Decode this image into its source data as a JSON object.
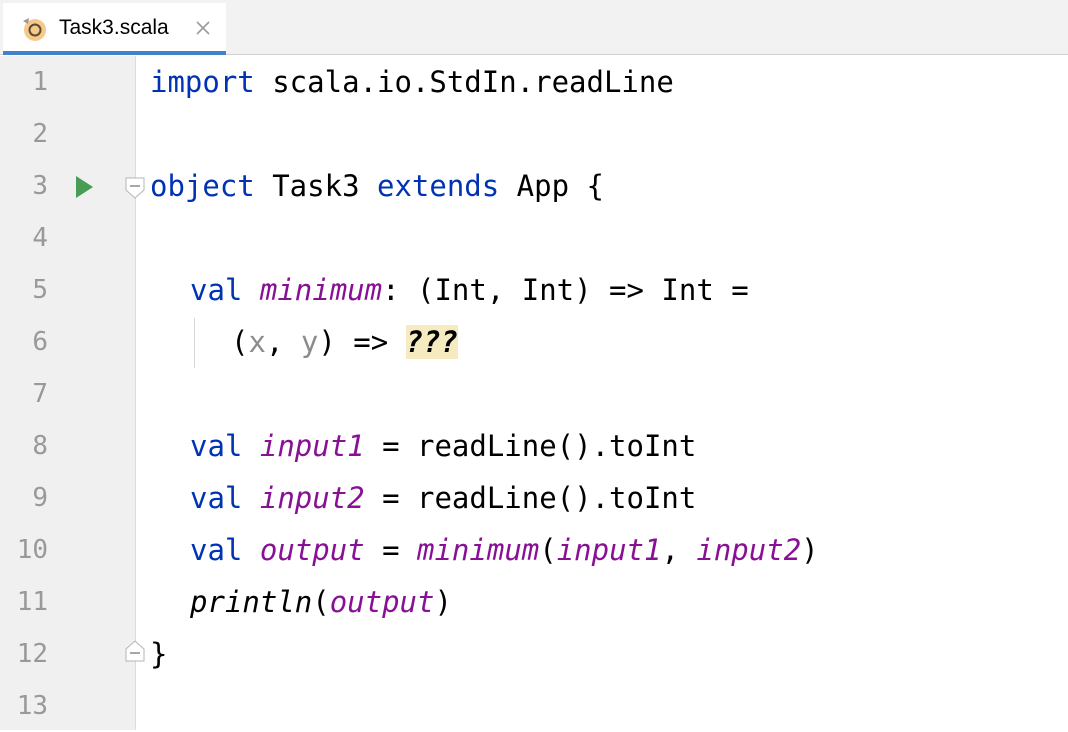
{
  "tab": {
    "file_name": "Task3.scala",
    "icon": "scala-object-icon",
    "close_icon": "close-icon"
  },
  "gutter": {
    "line_numbers": [
      "1",
      "2",
      "3",
      "4",
      "5",
      "6",
      "7",
      "8",
      "9",
      "10",
      "11",
      "12",
      "13"
    ],
    "run_icon": "run-icon",
    "fold_icon": "fold-icon"
  },
  "code": {
    "l1": {
      "kw": "import",
      "rest": " scala.io.StdIn.readLine"
    },
    "l3": {
      "kw1": "object",
      "name": " Task3 ",
      "kw2": "extends",
      "rest": " App {"
    },
    "l5": {
      "kw": "val",
      "sp": " ",
      "name": "minimum",
      "rest": ": (Int, Int) => Int ="
    },
    "l6": {
      "open": "(",
      "p1": "x",
      "comma": ", ",
      "p2": "y",
      "arrow": ") => ",
      "todo": "???"
    },
    "l8": {
      "kw": "val",
      "sp": " ",
      "name": "input1",
      "rest": " = readLine().toInt"
    },
    "l9": {
      "kw": "val",
      "sp": " ",
      "name": "input2",
      "rest": " = readLine().toInt"
    },
    "l10": {
      "kw": "val",
      "sp": " ",
      "name": "output",
      "eq": " = ",
      "call": "minimum",
      "open": "(",
      "a1": "input1",
      "comma": ", ",
      "a2": "input2",
      "close": ")"
    },
    "l11": {
      "fn": "println",
      "open": "(",
      "arg": "output",
      "close": ")"
    },
    "l12": {
      "brace": "}"
    }
  },
  "colors": {
    "keyword": "#0033b3",
    "field": "#871094",
    "parameter": "#8c8c8c",
    "todo_bg": "#f5eac0",
    "tab_underline": "#4083c9"
  }
}
